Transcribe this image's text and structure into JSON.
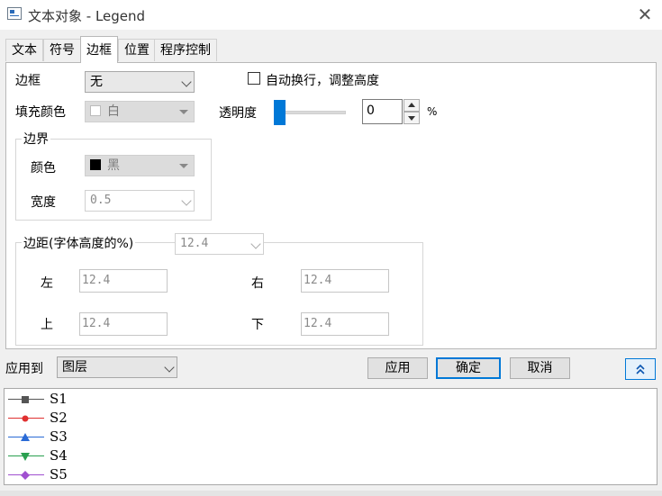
{
  "window": {
    "title": "文本对象 - Legend",
    "close_glyph": "✕"
  },
  "tabs": [
    {
      "label": "文本",
      "active": false
    },
    {
      "label": "符号",
      "active": false
    },
    {
      "label": "边框",
      "active": true
    },
    {
      "label": "位置",
      "active": false
    },
    {
      "label": "程序控制",
      "active": false
    }
  ],
  "border": {
    "frame_label": "边框",
    "frame_value": "无",
    "auto_wrap_label": "自动换行，调整高度",
    "auto_wrap_checked": false,
    "fill_label": "填充颜色",
    "fill_value": "白",
    "fill_color": "#ffffff",
    "transparency_label": "透明度",
    "transparency_value": "0",
    "transparency_unit": "%",
    "transparency_level": 0,
    "boundary_group": "边界",
    "color_label": "颜色",
    "color_value": "黑",
    "color_swatch": "#000000",
    "width_label": "宽度",
    "width_value": "0.5",
    "margin_group": "边距(字体高度的%)",
    "margin_value": "12.4",
    "left_label": "左",
    "left_value": "12.4",
    "right_label": "右",
    "right_value": "12.4",
    "top_label": "上",
    "top_value": "12.4",
    "bottom_label": "下",
    "bottom_value": "12.4"
  },
  "apply_to": {
    "label": "应用到",
    "value": "图层"
  },
  "buttons": {
    "apply": "应用",
    "ok": "确定",
    "cancel": "取消",
    "collapse_icon": "double-chevron-up-icon"
  },
  "legend": [
    {
      "label": "S1",
      "color": "#555555",
      "marker": "square"
    },
    {
      "label": "S2",
      "color": "#e03030",
      "marker": "circle"
    },
    {
      "label": "S3",
      "color": "#2a6bd6",
      "marker": "triangle-up"
    },
    {
      "label": "S4",
      "color": "#2aa050",
      "marker": "triangle-down"
    },
    {
      "label": "S5",
      "color": "#a050d0",
      "marker": "diamond"
    }
  ],
  "accent_color": "#0078d7"
}
